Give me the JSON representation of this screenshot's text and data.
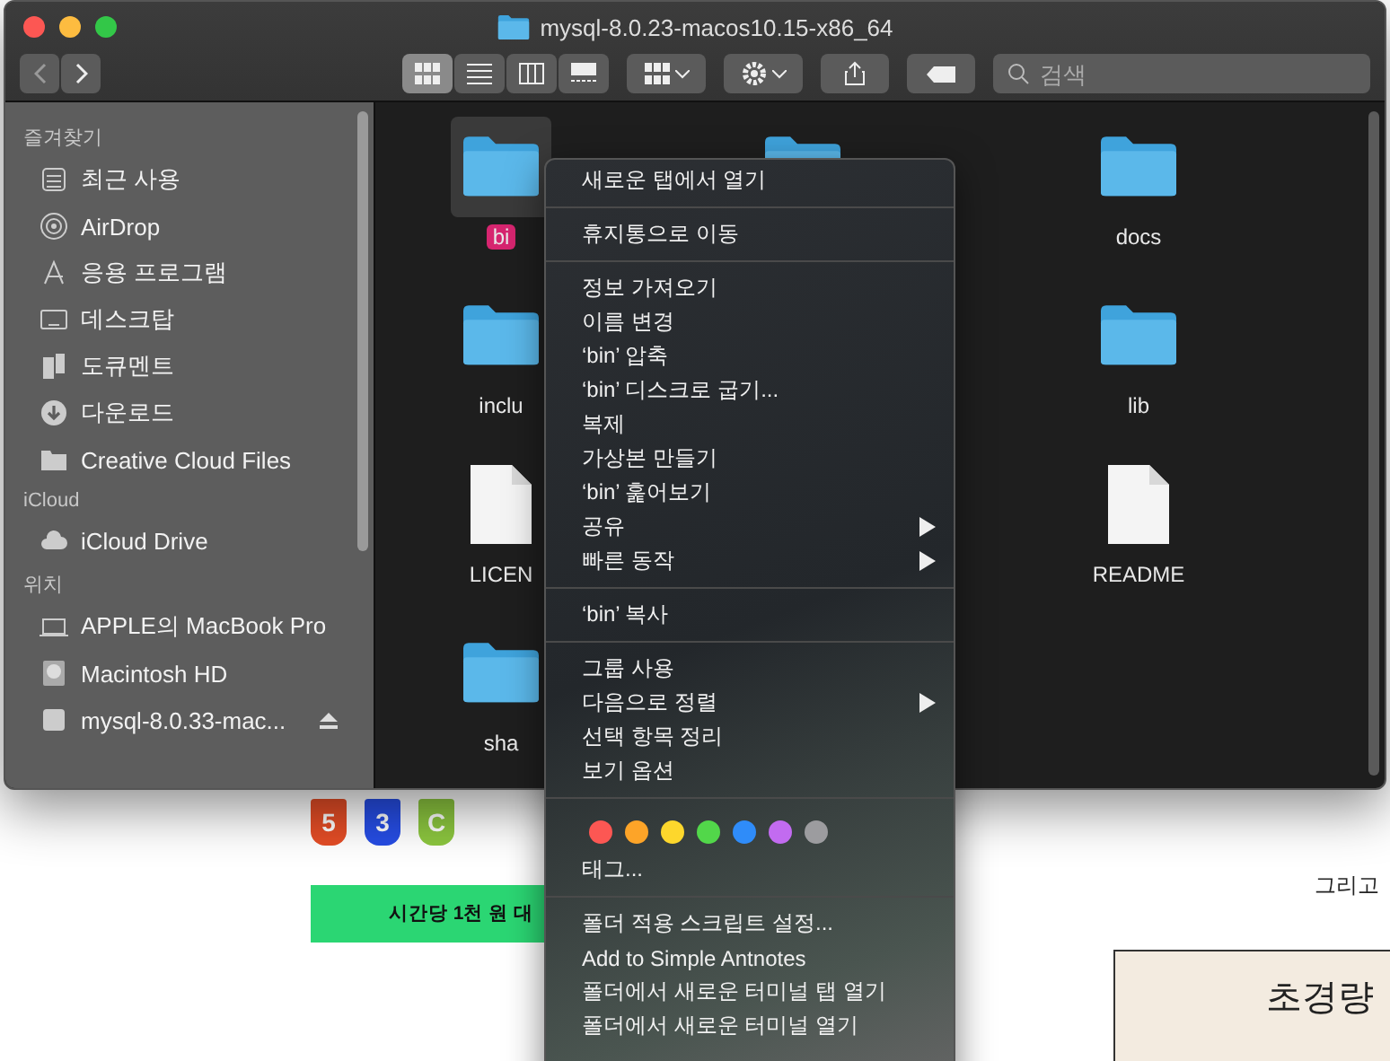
{
  "backdrop": {
    "badges": [
      {
        "label": "5",
        "color": "#e44d26"
      },
      {
        "label": "3",
        "color": "#264de4"
      },
      {
        "label": "C",
        "color": "#8cc63f"
      }
    ],
    "banner": "시간당 1천 원 대",
    "aside": "그리고",
    "promo": "초경량"
  },
  "window": {
    "title": "mysql-8.0.23-macos10.15-x86_64",
    "views": [
      {
        "kind": "icons",
        "selected": true
      },
      {
        "kind": "list",
        "selected": false
      },
      {
        "kind": "columns",
        "selected": false
      },
      {
        "kind": "gallery",
        "selected": false
      }
    ],
    "search": {
      "placeholder": "검색"
    }
  },
  "sidebar": {
    "sections": [
      {
        "heading": "즐겨찾기",
        "items": [
          {
            "label": "최근 사용",
            "kind": "recent"
          },
          {
            "label": "AirDrop",
            "kind": "airdrop"
          },
          {
            "label": "응용 프로그램",
            "kind": "apps"
          },
          {
            "label": "데스크탑",
            "kind": "desktop"
          },
          {
            "label": "도큐멘트",
            "kind": "docs"
          },
          {
            "label": "다운로드",
            "kind": "download"
          },
          {
            "label": "Creative Cloud Files",
            "kind": "folder"
          }
        ]
      },
      {
        "heading": "iCloud",
        "items": [
          {
            "label": "iCloud Drive",
            "kind": "cloud"
          }
        ]
      },
      {
        "heading": "위치",
        "items": [
          {
            "label": "APPLE의 MacBook Pro",
            "kind": "laptop"
          },
          {
            "label": "Macintosh HD",
            "kind": "disk"
          },
          {
            "label": "mysql-8.0.33-mac...",
            "kind": "volume",
            "eject": true
          }
        ]
      }
    ]
  },
  "files": [
    {
      "name": "bi",
      "kind": "folder",
      "selected": true,
      "color": "#d6256f"
    },
    {
      "kind": "folder",
      "selected": false
    },
    {
      "name": "docs",
      "kind": "folder",
      "selected": false
    },
    {
      "name": "inclu",
      "kind": "folder",
      "selected": false
    },
    {
      "kind": "none"
    },
    {
      "name": "lib",
      "kind": "folder",
      "selected": false
    },
    {
      "name": "LICEN",
      "kind": "file",
      "selected": false
    },
    {
      "kind": "none"
    },
    {
      "name": "README",
      "kind": "file",
      "selected": false
    },
    {
      "name": "sha",
      "kind": "folder",
      "selected": false
    }
  ],
  "context_menu": {
    "groups": [
      [
        {
          "label": "새로운 탭에서 열기",
          "submenu": false
        }
      ],
      [
        {
          "label": "휴지통으로 이동",
          "submenu": false
        }
      ],
      [
        {
          "label": "정보 가져오기",
          "submenu": false
        },
        {
          "label": "이름 변경",
          "submenu": false
        },
        {
          "label": "‘bin’ 압축",
          "submenu": false
        },
        {
          "label": "‘bin’ 디스크로 굽기...",
          "submenu": false
        },
        {
          "label": "복제",
          "submenu": false
        },
        {
          "label": "가상본 만들기",
          "submenu": false
        },
        {
          "label": "‘bin’ 훑어보기",
          "submenu": false
        },
        {
          "label": "공유",
          "submenu": true
        },
        {
          "label": "빠른 동작",
          "submenu": true
        }
      ],
      [
        {
          "label": "‘bin’ 복사",
          "submenu": false
        }
      ],
      [
        {
          "label": "그룹 사용",
          "submenu": false
        },
        {
          "label": "다음으로 정렬",
          "submenu": true
        },
        {
          "label": "선택 항목 정리",
          "submenu": false
        },
        {
          "label": "보기 옵션",
          "submenu": false
        }
      ]
    ],
    "tag_colors": [
      {
        "color": "#fc5753"
      },
      {
        "color": "#fda428"
      },
      {
        "color": "#fdd72c"
      },
      {
        "color": "#52d74a"
      },
      {
        "color": "#2f8cf9"
      },
      {
        "color": "#c26bf0"
      },
      {
        "color": "#9c9c9f"
      }
    ],
    "tags_label": "태그...",
    "services": [
      {
        "label": "폴더 적용 스크립트 설정..."
      },
      {
        "label": "Add to Simple Antnotes"
      },
      {
        "label": "폴더에서 새로운 터미널 탭 열기"
      },
      {
        "label": "폴더에서 새로운 터미널 열기"
      }
    ]
  }
}
